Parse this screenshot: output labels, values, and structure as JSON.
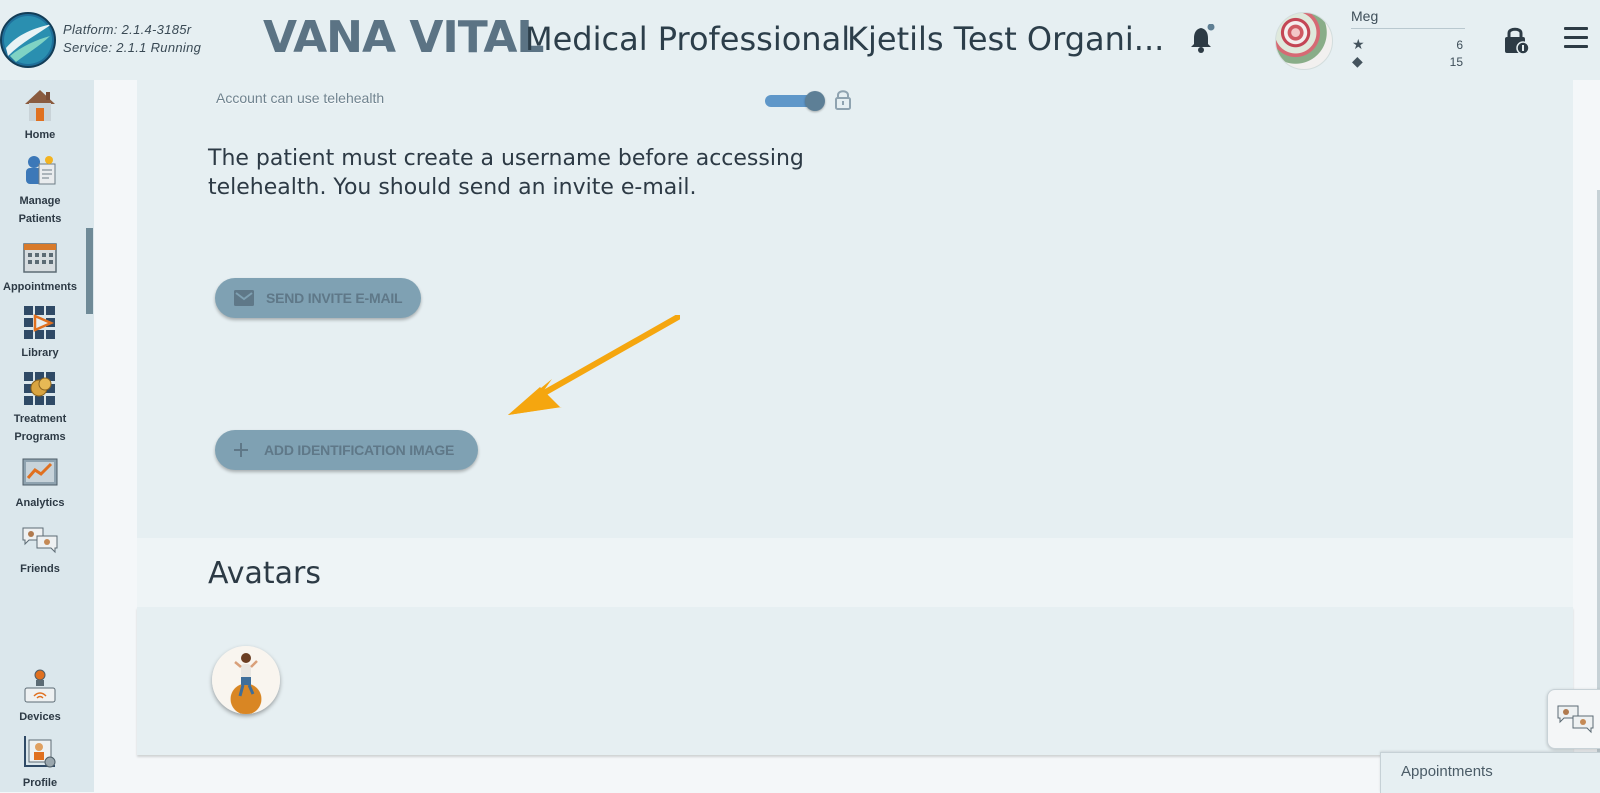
{
  "header": {
    "platform": "Platform: 2.1.4-3185r",
    "service": "Service:   2.1.1 Running",
    "app_title": "VANA VITAL",
    "role": "Medical Professional",
    "organization": "Kjetils Test Organi...",
    "user_name": "Meg",
    "stars": "6",
    "gems": "15",
    "icons": [
      "app-logo-icon",
      "bell-icon",
      "star-icon",
      "diamond-icon",
      "lock-icon",
      "hamburger-menu-icon"
    ]
  },
  "sidebar": {
    "items": [
      {
        "label": "Home",
        "icon": "home-icon"
      },
      {
        "label": "Manage Patients",
        "icon": "patients-icon"
      },
      {
        "label": "Appointments",
        "icon": "calendar-icon"
      },
      {
        "label": "Library",
        "icon": "library-icon"
      },
      {
        "label": "Treatment Programs",
        "icon": "treatment-icon"
      },
      {
        "label": "Analytics",
        "icon": "analytics-icon"
      },
      {
        "label": "Friends",
        "icon": "friends-icon"
      },
      {
        "label": "Devices",
        "icon": "devices-icon"
      },
      {
        "label": "Profile",
        "icon": "profile-icon"
      }
    ]
  },
  "telehealth": {
    "label": "Account can use telehealth",
    "enabled": true,
    "notice": "The patient must create a username before accessing telehealth. You should send an invite e-mail.",
    "send_invite_label": "SEND INVITE E-MAIL",
    "add_image_label": "ADD IDENTIFICATION IMAGE"
  },
  "avatars": {
    "title": "Avatars"
  },
  "footer": {
    "appointments_tab": "Appointments"
  },
  "colors": {
    "accent_arrow": "#f5a60f",
    "toggle_track": "#5f97c9",
    "button_bg": "#7fa1b3",
    "header_title": "#5b7384"
  }
}
